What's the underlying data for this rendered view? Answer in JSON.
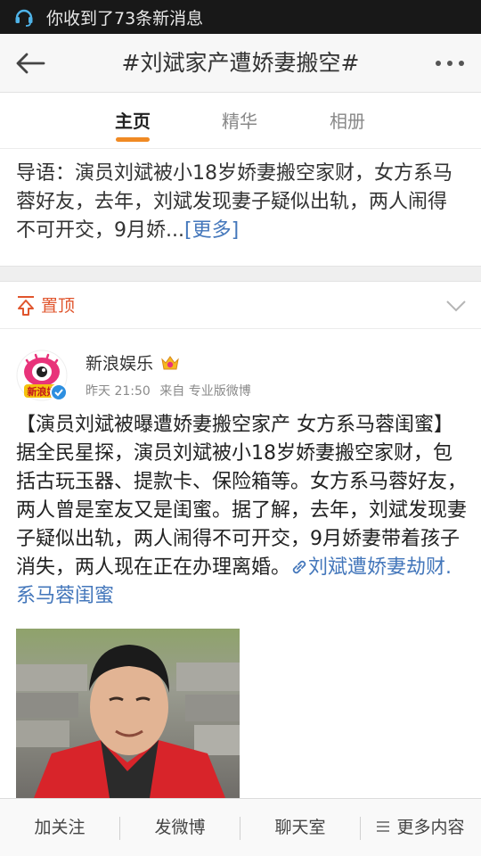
{
  "status_bar": {
    "notification": "你收到了73条新消息"
  },
  "nav": {
    "title": "#刘斌家产遭娇妻搬空#"
  },
  "tabs": [
    {
      "label": "主页",
      "active": true
    },
    {
      "label": "精华",
      "active": false
    },
    {
      "label": "相册",
      "active": false
    }
  ],
  "intro": {
    "text": "导语：演员刘斌被小18岁娇妻搬空家财，女方系马蓉好友，去年，刘斌发现妻子疑似出轨，两人闹得不可开交，9月娇...",
    "more": "[更多]"
  },
  "pinned": {
    "label": "置顶"
  },
  "post": {
    "author": "新浪娱乐",
    "time": "昨天 21:50",
    "source": "来自 专业版微博",
    "body": "【演员刘斌被曝遭娇妻搬空家产 女方系马蓉闺蜜】据全民星探，演员刘斌被小18岁娇妻搬空家财，包括古玩玉器、提款卡、保险箱等。女方系马蓉好友，两人曾是室友又是闺蜜。据了解，去年，刘斌发现妻子疑似出轨，两人闹得不可开交，9月娇妻带着孩子消失，两人现在正在办理离婚。",
    "topic_link": "刘斌遭娇妻劫财.系马蓉闺蜜",
    "avatar_text": "新浪娱"
  },
  "toolbar": {
    "follow": "加关注",
    "post": "发微博",
    "chat": "聊天室",
    "more": "更多内容"
  },
  "colors": {
    "accent": "#f08a24",
    "link": "#4477bb",
    "pinned": "#e0552d"
  }
}
